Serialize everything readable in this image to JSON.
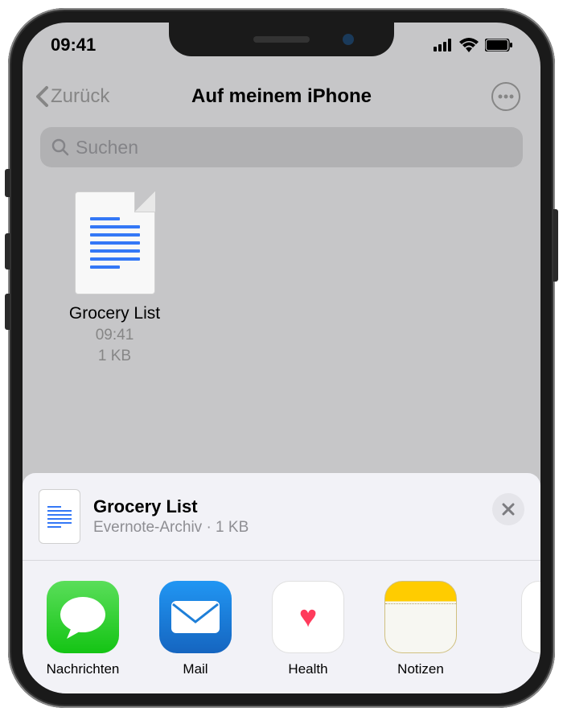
{
  "status": {
    "time": "09:41"
  },
  "nav": {
    "back_label": "Zurück",
    "title": "Auf meinem iPhone"
  },
  "search": {
    "placeholder": "Suchen"
  },
  "file": {
    "name": "Grocery List",
    "time": "09:41",
    "size": "1 KB"
  },
  "share": {
    "title": "Grocery List",
    "subtitle": "Evernote-Archiv · 1 KB",
    "apps": [
      {
        "label": "Nachrichten"
      },
      {
        "label": "Mail"
      },
      {
        "label": "Health"
      },
      {
        "label": "Notizen"
      }
    ]
  }
}
